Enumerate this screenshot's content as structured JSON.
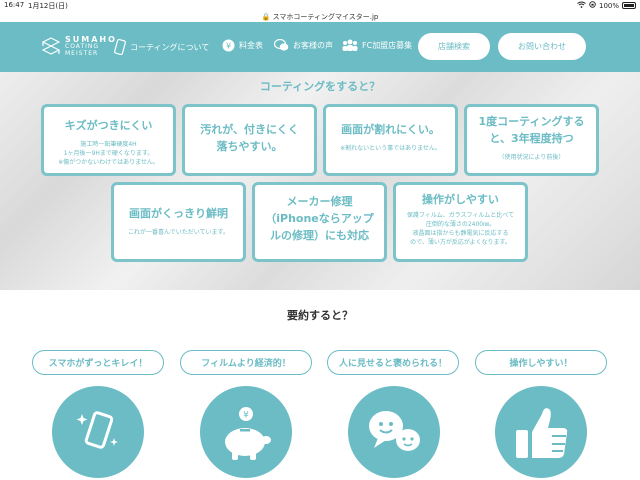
{
  "status_bar": {
    "time": "16:47",
    "date": "1月12日(日)",
    "battery": "100%"
  },
  "address_bar": {
    "url": "スマホコーティングマイスター.jp"
  },
  "nav": {
    "logo_line1": "SUMAHO",
    "logo_line2": "COATING",
    "logo_line3": "MEISTER",
    "items": [
      {
        "label": "コーティングについて",
        "icon": "phone-icon"
      },
      {
        "label": "料金表",
        "icon": "yen-icon"
      },
      {
        "label": "お客様の声",
        "icon": "speech-bubble-icon"
      },
      {
        "label": "FC加盟店募集",
        "icon": "people-icon"
      }
    ],
    "store_search": "店舗検索",
    "contact": "お問い合わせ"
  },
  "hero": {
    "title": "コーティングをすると？",
    "cards": [
      {
        "title": "キズがつきにくい",
        "sub1": "施工時ー鉛筆硬度4H",
        "sub2": "1ヶ月後ー9Hまで硬くなります。",
        "sub3": "※傷がつかないわけではありません。"
      },
      {
        "title1": "汚れが、付きにくく",
        "title2": "落ちやすい。"
      },
      {
        "title": "画面が割れにくい。",
        "sub1": "※割れないという事ではありません。"
      },
      {
        "title1": "1度コーティングする",
        "title2": "と、3年程度持つ",
        "sub1": "（使用状況により前後）"
      },
      {
        "title": "画面がくっきり鮮明",
        "sub1": "これが一番喜んでいただいています。"
      },
      {
        "title1": "メーカー修理",
        "title2": "（iPhoneならアップ",
        "title3": "ルの修理）にも対応"
      },
      {
        "title": "操作がしやすい",
        "sub1": "保護フィルム、ガラスフィルムと比べて",
        "sub2": "圧倒的な薄さの2400㎚。",
        "sub3": "液晶面は指からも静電気に反応する",
        "sub4": "ので、薄い方が反応がよくなります。"
      }
    ]
  },
  "summary": {
    "title": "要約すると？",
    "pills": [
      "スマホがずっとキレイ！",
      "フィルムより経済的！",
      "人に見せると褒められる！",
      "操作しやすい！"
    ],
    "icons": [
      "sparkling-phone-icon",
      "piggy-bank-icon",
      "chat-faces-icon",
      "thumbs-up-icon"
    ]
  },
  "colors": {
    "accent": "#6bbcc4",
    "card_border": "#7cc3ca"
  }
}
